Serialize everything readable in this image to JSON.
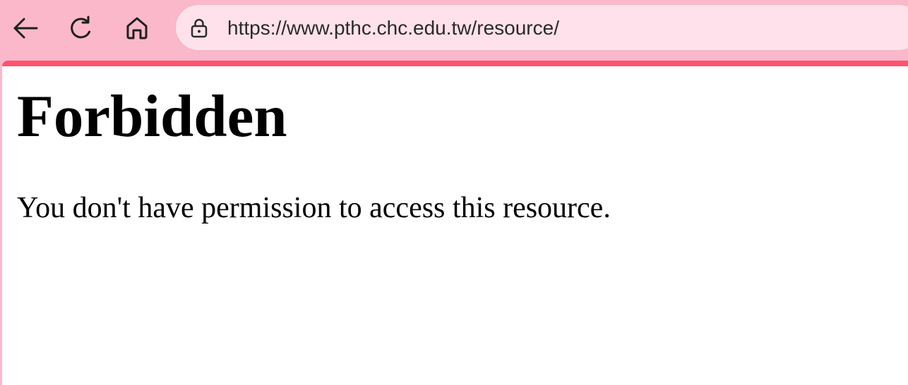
{
  "browser": {
    "address_bar": {
      "url": "https://www.pthc.chc.edu.tw/resource/"
    },
    "icons": {
      "back": "back-arrow-icon",
      "reload": "reload-icon",
      "home": "home-icon",
      "site_info": "lock-icon"
    },
    "colors": {
      "toolbar_bg": "#fcb8cb",
      "address_bar_bg": "#fee1ea",
      "accent": "#ff526e"
    }
  },
  "page": {
    "title": "Forbidden",
    "message": "You don't have permission to access this resource."
  }
}
